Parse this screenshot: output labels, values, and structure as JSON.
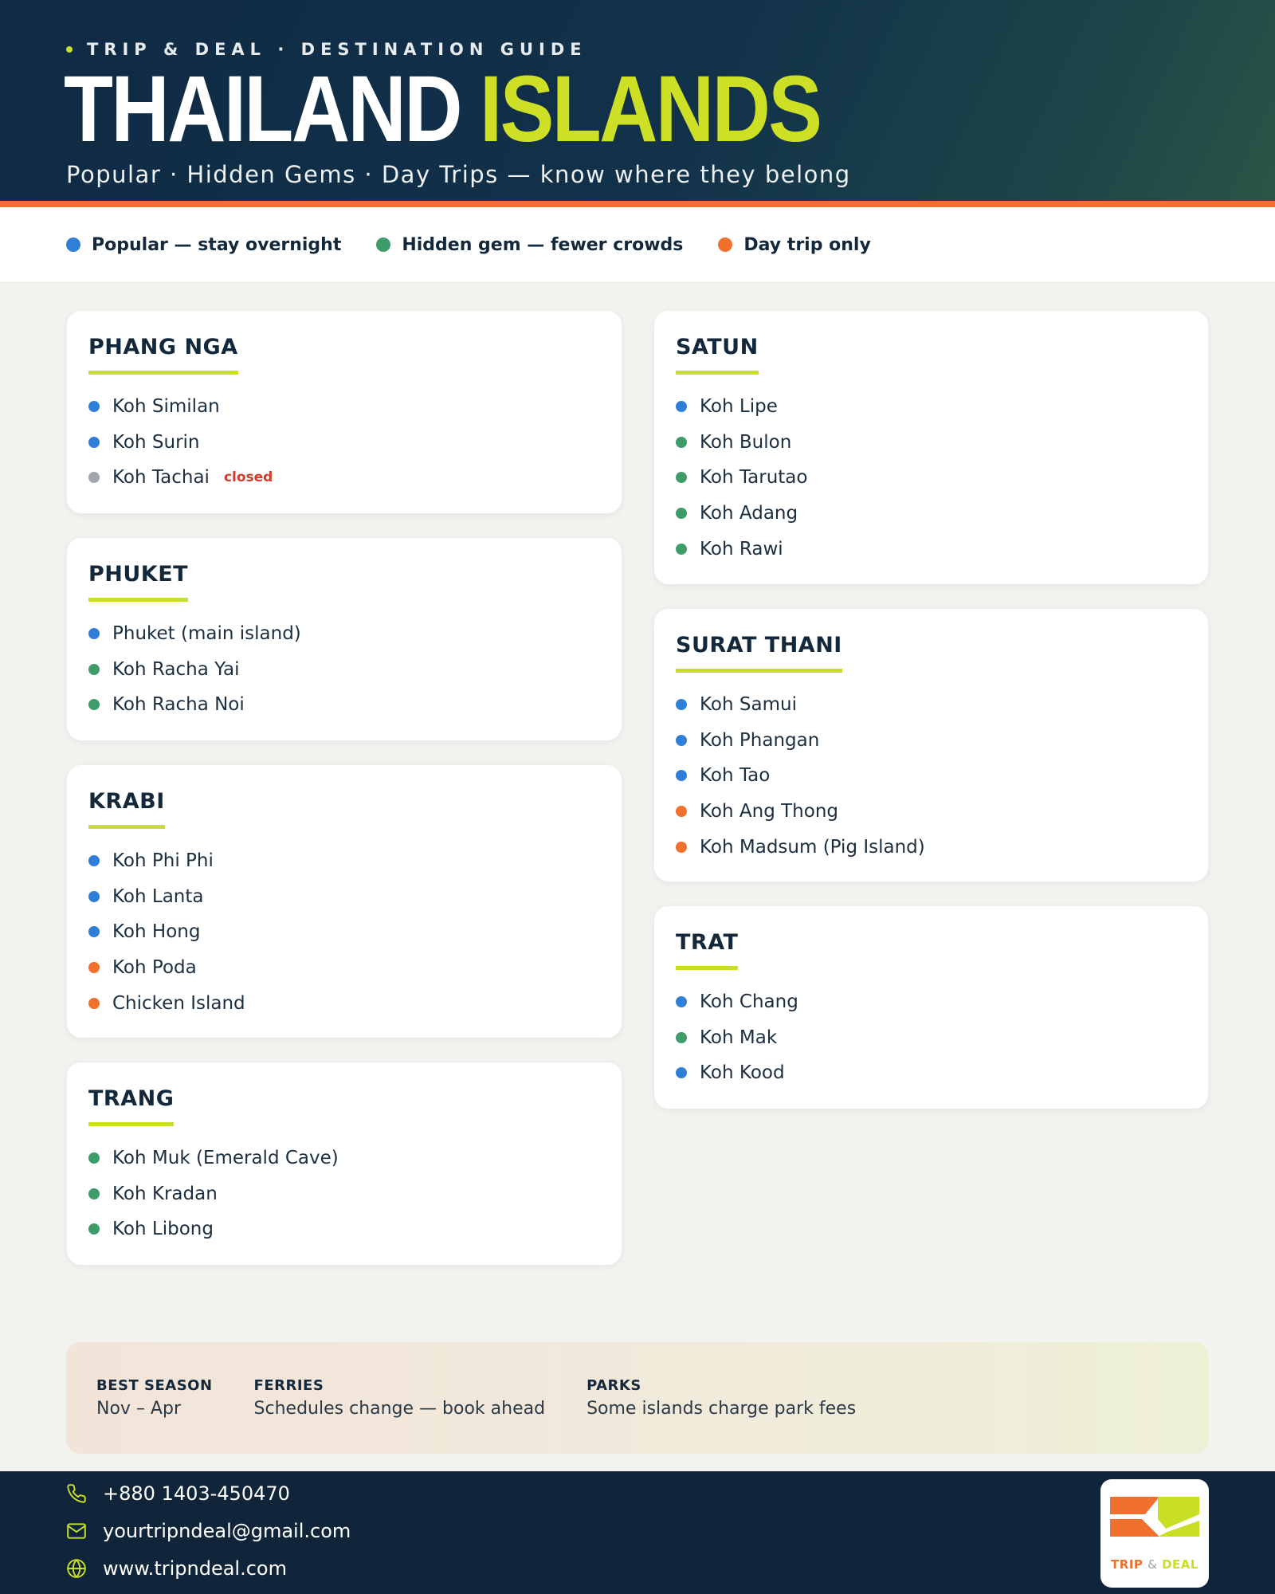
{
  "header": {
    "eyebrow": "TRIP & DEAL · DESTINATION GUIDE",
    "title_part1": "THAILAND",
    "title_part2": "ISLANDS",
    "subtitle": "Popular · Hidden Gems · Day Trips — know where they belong"
  },
  "colors": {
    "popular": "#2f7fd8",
    "hidden": "#3e9c6a",
    "daytrip": "#f0702d",
    "closed": "#a0a6ad",
    "accent": "#c8df25"
  },
  "legend": [
    {
      "label": "Popular — stay overnight",
      "type": "popular"
    },
    {
      "label": "Hidden gem — fewer crowds",
      "type": "hidden"
    },
    {
      "label": "Day trip only",
      "type": "daytrip"
    }
  ],
  "regions": [
    {
      "name": "PHANG NGA",
      "islands": [
        {
          "name": "Koh Similan",
          "type": "popular"
        },
        {
          "name": "Koh Surin",
          "type": "popular"
        },
        {
          "name": "Koh Tachai",
          "type": "closed",
          "note": "closed"
        }
      ]
    },
    {
      "name": "PHUKET",
      "islands": [
        {
          "name": "Phuket (main island)",
          "type": "popular"
        },
        {
          "name": "Koh Racha Yai",
          "type": "hidden"
        },
        {
          "name": "Koh Racha Noi",
          "type": "hidden"
        }
      ]
    },
    {
      "name": "KRABI",
      "islands": [
        {
          "name": "Koh Phi Phi",
          "type": "popular"
        },
        {
          "name": "Koh Lanta",
          "type": "popular"
        },
        {
          "name": "Koh Hong",
          "type": "popular"
        },
        {
          "name": "Koh Poda",
          "type": "daytrip"
        },
        {
          "name": "Chicken Island",
          "type": "daytrip"
        }
      ]
    },
    {
      "name": "TRANG",
      "islands": [
        {
          "name": "Koh Muk (Emerald Cave)",
          "type": "hidden"
        },
        {
          "name": "Koh Kradan",
          "type": "hidden"
        },
        {
          "name": "Koh Libong",
          "type": "hidden"
        }
      ]
    },
    {
      "name": "SATUN",
      "islands": [
        {
          "name": "Koh Lipe",
          "type": "popular"
        },
        {
          "name": "Koh Bulon",
          "type": "hidden"
        },
        {
          "name": "Koh Tarutao",
          "type": "hidden"
        },
        {
          "name": "Koh Adang",
          "type": "hidden"
        },
        {
          "name": "Koh Rawi",
          "type": "hidden"
        }
      ]
    },
    {
      "name": "SURAT THANI",
      "islands": [
        {
          "name": "Koh Samui",
          "type": "popular"
        },
        {
          "name": "Koh Phangan",
          "type": "popular"
        },
        {
          "name": "Koh Tao",
          "type": "popular"
        },
        {
          "name": "Koh Ang Thong",
          "type": "daytrip"
        },
        {
          "name": "Koh Madsum (Pig Island)",
          "type": "daytrip"
        }
      ]
    },
    {
      "name": "TRAT",
      "islands": [
        {
          "name": "Koh Chang",
          "type": "popular"
        },
        {
          "name": "Koh Mak",
          "type": "hidden"
        },
        {
          "name": "Koh Kood",
          "type": "popular"
        }
      ]
    }
  ],
  "info": [
    {
      "label": "BEST SEASON",
      "value": "Nov – Apr"
    },
    {
      "label": "FERRIES",
      "value": "Schedules change — book ahead"
    },
    {
      "label": "PARKS",
      "value": "Some islands charge park fees"
    }
  ],
  "footer": {
    "phone": "+880 1403-450470",
    "email": "yourtripndeal@gmail.com",
    "website": "www.tripndeal.com",
    "logo_word1": "TRIP",
    "logo_amp": "&",
    "logo_word2": "DEAL"
  }
}
